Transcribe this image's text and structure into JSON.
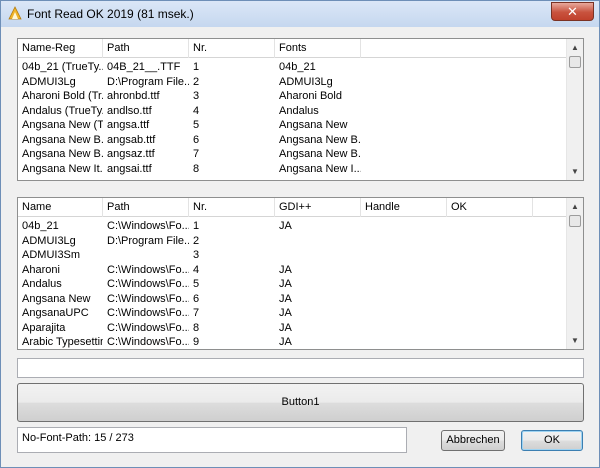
{
  "window": {
    "title": "Font Read OK 2019 (81 msek.)",
    "close_label": "✕"
  },
  "grid1": {
    "columns": [
      "Name-Reg",
      "Path",
      "Nr.",
      "Fonts"
    ],
    "rows": [
      [
        "04b_21 (TrueTy...",
        "04B_21__.TTF",
        "1",
        "04b_21"
      ],
      [
        "ADMUI3Lg",
        "D:\\Program File...",
        "2",
        "ADMUI3Lg"
      ],
      [
        "Aharoni Bold (Tr...",
        "ahronbd.ttf",
        "3",
        "Aharoni Bold"
      ],
      [
        "Andalus (TrueTy...",
        "andlso.ttf",
        "4",
        "Andalus"
      ],
      [
        "Angsana New (T...",
        "angsa.ttf",
        "5",
        "Angsana New"
      ],
      [
        "Angsana New B...",
        "angsab.ttf",
        "6",
        "Angsana New B..."
      ],
      [
        "Angsana New B...",
        "angsaz.ttf",
        "7",
        "Angsana New B..."
      ],
      [
        "Angsana New It...",
        "angsai.ttf",
        "8",
        "Angsana New I..."
      ]
    ]
  },
  "grid2": {
    "columns": [
      "Name",
      "Path",
      "Nr.",
      "GDI++",
      "Handle",
      "OK"
    ],
    "rows": [
      [
        "04b_21",
        "C:\\Windows\\Fo...",
        "1",
        "JA",
        "",
        ""
      ],
      [
        "ADMUI3Lg",
        "D:\\Program File...",
        "2",
        "",
        "",
        ""
      ],
      [
        "ADMUI3Sm",
        "",
        "3",
        "",
        "",
        ""
      ],
      [
        "Aharoni",
        "C:\\Windows\\Fo...",
        "4",
        "JA",
        "",
        ""
      ],
      [
        "Andalus",
        "C:\\Windows\\Fo...",
        "5",
        "JA",
        "",
        ""
      ],
      [
        "Angsana New",
        "C:\\Windows\\Fo...",
        "6",
        "JA",
        "",
        ""
      ],
      [
        "AngsanaUPC",
        "C:\\Windows\\Fo...",
        "7",
        "JA",
        "",
        ""
      ],
      [
        "Aparajita",
        "C:\\Windows\\Fo...",
        "8",
        "JA",
        "",
        ""
      ],
      [
        "Arabic Typesetting",
        "C:\\Windows\\Fo...",
        "9",
        "JA",
        "",
        ""
      ]
    ]
  },
  "input_value": "",
  "button1_label": "Button1",
  "status_text": "No-Font-Path: 15 / 273",
  "cancel_label": "Abbrechen",
  "ok_label": "OK",
  "icons": {
    "app": "font-app-icon",
    "scroll_up": "scroll-up-arrow-icon",
    "scroll_down": "scroll-down-arrow-icon"
  }
}
